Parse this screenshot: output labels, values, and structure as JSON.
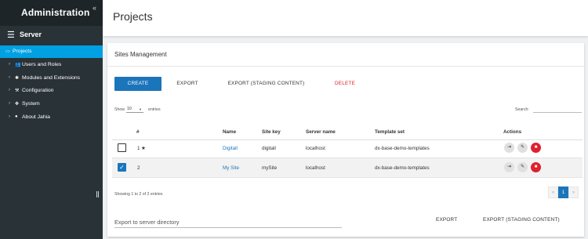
{
  "sidebar": {
    "title": "Administration",
    "collapse_icon": "«",
    "section": {
      "icon": "list-icon",
      "label": "Server"
    },
    "items": [
      {
        "label": "Projects",
        "icon": "folder-icon",
        "active": true
      },
      {
        "label": "Users and Roles",
        "icon": "users-icon"
      },
      {
        "label": "Modules and Extensions",
        "icon": "puzzle-icon"
      },
      {
        "label": "Configuration",
        "icon": "wrench-icon"
      },
      {
        "label": "System",
        "icon": "cog-icon"
      },
      {
        "label": "About Jahia",
        "icon": "info-icon"
      }
    ]
  },
  "header": {
    "title": "Projects"
  },
  "card": {
    "title": "Sites Management",
    "buttons": {
      "create": "CREATE",
      "export": "EXPORT",
      "export_staging": "EXPORT (STAGING CONTENT)",
      "delete": "DELETE"
    },
    "show_label": "Show",
    "show_value": "10",
    "entries_label": "entries",
    "search_label": "Search:",
    "table": {
      "headers": [
        "#",
        "Name",
        "Site key",
        "Server name",
        "Template set",
        "Actions"
      ],
      "rows": [
        {
          "checked": false,
          "num": "1",
          "star": "★",
          "name": "Digitall",
          "key": "digitall",
          "server": "localhost",
          "template": "dx-base-demo-templates"
        },
        {
          "checked": true,
          "num": "2",
          "star": "",
          "name": "My Site",
          "key": "mySite",
          "server": "localhost",
          "template": "dx-base-demo-templates"
        }
      ]
    },
    "showing": "Showing 1 to 2 of 2 entries",
    "pagination": {
      "prev": "«",
      "page": "1",
      "next": "»"
    },
    "export_placeholder": "Export to server directory",
    "export_button": "EXPORT",
    "export_staging_button": "EXPORT (STAGING CONTENT)"
  },
  "colors": {
    "sidebar": "#293237",
    "accent": "#00a0e3",
    "primary": "#1b75bb",
    "danger": "#e0202d"
  }
}
